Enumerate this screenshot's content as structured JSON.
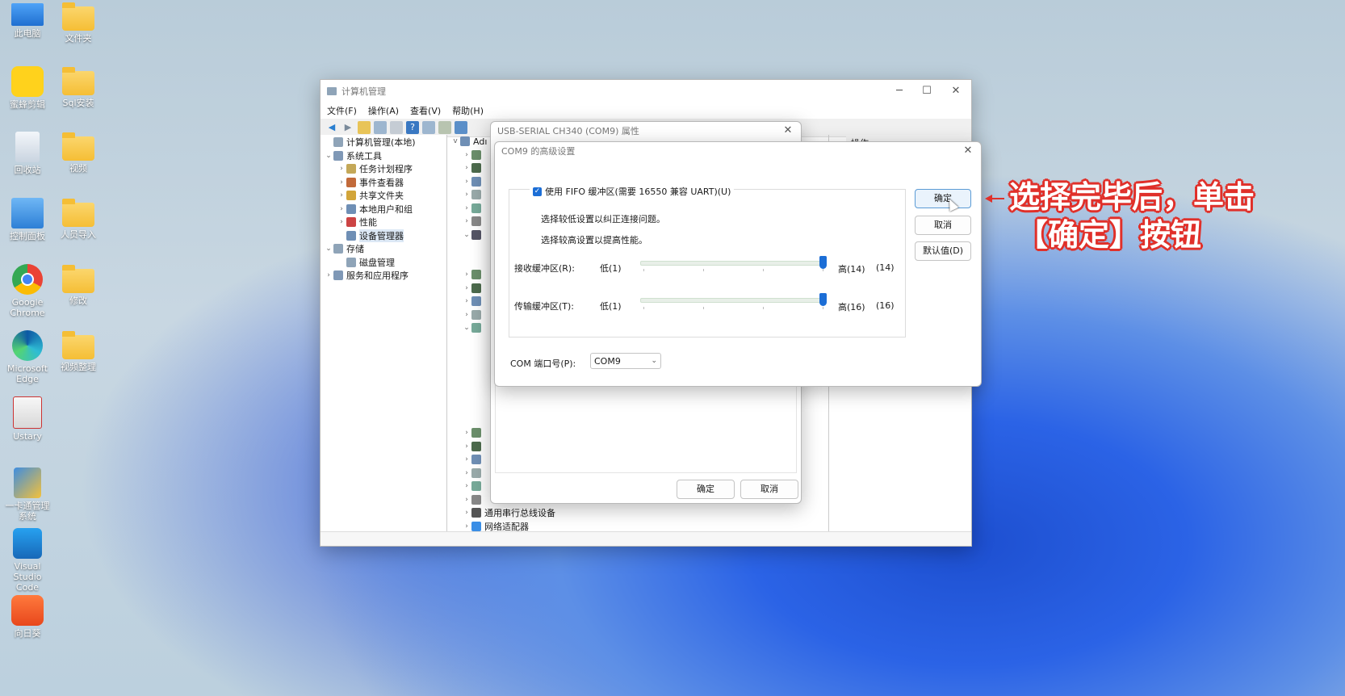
{
  "desktop": {
    "icons": [
      {
        "label": "此电脑",
        "kind": "pc-icon",
        "color": "#2f7be0"
      },
      {
        "label": "文件夹",
        "kind": "folder-icon"
      },
      {
        "label": "蜜蜂剪辑",
        "kind": "app-icon",
        "color": "#ffcc00"
      },
      {
        "label": "Sql安装",
        "kind": "folder-icon"
      },
      {
        "label": "回收站",
        "kind": "recycle-bin-icon",
        "color": "#e8eef5"
      },
      {
        "label": "视频",
        "kind": "folder-icon"
      },
      {
        "label": "控制面板",
        "kind": "control-panel-icon",
        "color": "#3a8ee6"
      },
      {
        "label": "人员导入",
        "kind": "folder-icon"
      },
      {
        "label": "Google Chrome",
        "kind": "chrome-icon"
      },
      {
        "label": "修改",
        "kind": "folder-icon"
      },
      {
        "label": "Microsoft Edge",
        "kind": "edge-icon"
      },
      {
        "label": "视频整理",
        "kind": "folder-icon"
      },
      {
        "label": "Ustary",
        "kind": "ustary-icon"
      },
      {
        "label": "一卡通管理系统",
        "kind": "setup-icon"
      },
      {
        "label": "Visual Studio Code",
        "kind": "vscode-icon",
        "color": "#1f8ad2"
      },
      {
        "label": "向日葵",
        "kind": "sunlogin-icon",
        "color": "#f25a22"
      }
    ]
  },
  "mmc": {
    "title": "计算机管理",
    "menu": [
      "文件(F)",
      "操作(A)",
      "查看(V)",
      "帮助(H)"
    ],
    "tree": [
      {
        "label": "计算机管理(本地)",
        "depth": 0,
        "arrow": ""
      },
      {
        "label": "系统工具",
        "depth": 0,
        "arrow": "v"
      },
      {
        "label": "任务计划程序",
        "depth": 1,
        "arrow": ">"
      },
      {
        "label": "事件查看器",
        "depth": 1,
        "arrow": ">"
      },
      {
        "label": "共享文件夹",
        "depth": 1,
        "arrow": ">"
      },
      {
        "label": "本地用户和组",
        "depth": 1,
        "arrow": ">"
      },
      {
        "label": "性能",
        "depth": 1,
        "arrow": ">"
      },
      {
        "label": "设备管理器",
        "depth": 1,
        "arrow": "",
        "selected": true
      },
      {
        "label": "存储",
        "depth": 0,
        "arrow": "v"
      },
      {
        "label": "磁盘管理",
        "depth": 1,
        "arrow": ""
      },
      {
        "label": "服务和应用程序",
        "depth": 0,
        "arrow": ">"
      }
    ],
    "devices_top_label": "Adı",
    "devices_bottom": [
      "通用串行总线设备",
      "网络适配器"
    ],
    "actions_header": "操作"
  },
  "props": {
    "title": "USB-SERIAL CH340 (COM9) 属性",
    "ok": "确定",
    "cancel": "取消"
  },
  "advanced": {
    "title": "COM9 的高级设置",
    "fifo_label": "使用 FIFO 缓冲区(需要 16550 兼容 UART)(U)",
    "fifo_checked": true,
    "hint1": "选择较低设置以纠正连接问题。",
    "hint2": "选择较高设置以提高性能。",
    "rx_label": "接收缓冲区(R):",
    "rx_low": "低(1)",
    "rx_high": "高(14)",
    "rx_value": "(14)",
    "rx_level": 1.0,
    "tx_label": "传输缓冲区(T):",
    "tx_low": "低(1)",
    "tx_high": "高(16)",
    "tx_value": "(16)",
    "tx_level": 1.0,
    "com_label": "COM 端口号(P):",
    "com_value": "COM9",
    "ok": "确定",
    "cancel": "取消",
    "default": "默认值(D)"
  },
  "annotation": {
    "line1": "选择完毕后，单击",
    "line2": "【确定】按钮",
    "color": "#e0302a"
  }
}
